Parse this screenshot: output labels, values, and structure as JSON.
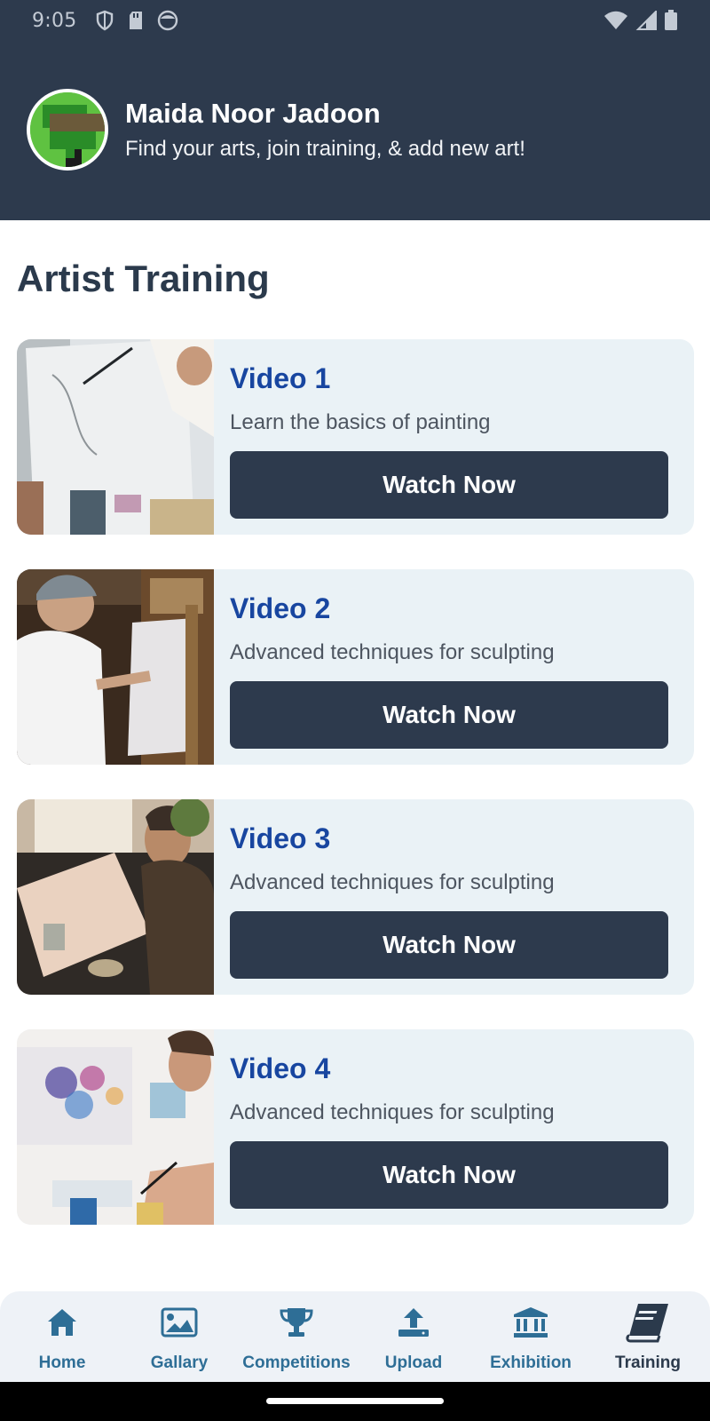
{
  "status_bar": {
    "time": "9:05"
  },
  "profile": {
    "name": "Maida Noor Jadoon",
    "subtitle": "Find your arts, join training, & add new art!"
  },
  "page": {
    "title": "Artist Training"
  },
  "videos": [
    {
      "title": "Video 1",
      "description": "Learn the basics of painting",
      "button_label": "Watch Now"
    },
    {
      "title": "Video 2",
      "description": "Advanced techniques for sculpting",
      "button_label": "Watch Now"
    },
    {
      "title": "Video 3",
      "description": "Advanced techniques for sculpting",
      "button_label": "Watch Now"
    },
    {
      "title": "Video 4",
      "description": "Advanced techniques for sculpting",
      "button_label": "Watch Now"
    }
  ],
  "bottom_nav": {
    "items": [
      {
        "label": "Home",
        "icon": "home-icon",
        "active": false
      },
      {
        "label": "Gallary",
        "icon": "image-icon",
        "active": false
      },
      {
        "label": "Competitions",
        "icon": "trophy-icon",
        "active": false
      },
      {
        "label": "Upload",
        "icon": "upload-icon",
        "active": false
      },
      {
        "label": "Exhibition",
        "icon": "museum-icon",
        "active": false
      },
      {
        "label": "Training",
        "icon": "book-icon",
        "active": true
      }
    ]
  },
  "colors": {
    "header": "#2d3a4d",
    "card_background": "#eaf2f6",
    "video_title": "#1846a0",
    "nav_label": "#2e6e96",
    "nav_active": "#2b3a4c"
  }
}
